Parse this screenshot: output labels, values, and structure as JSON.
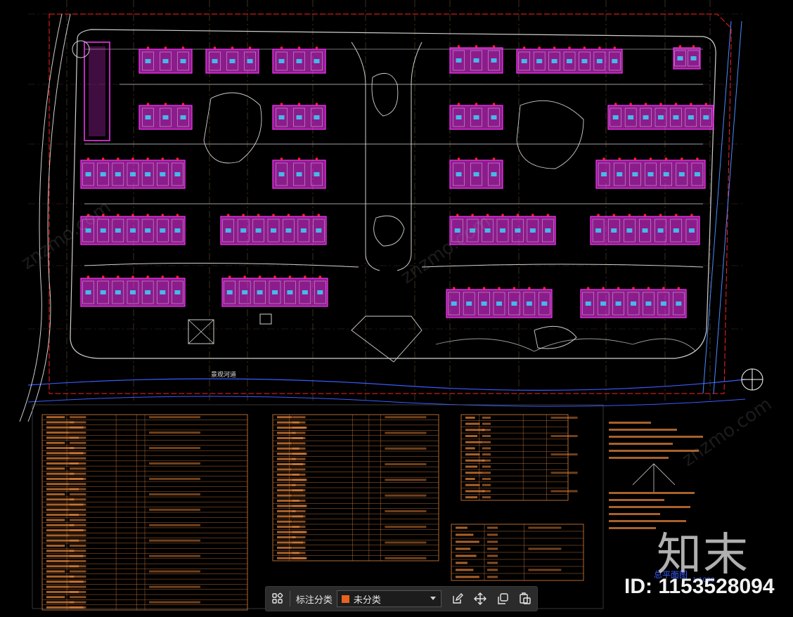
{
  "toolbar": {
    "classify_label": "标注分类",
    "category_value": "未分类",
    "category_color": "#e8631f"
  },
  "watermark": {
    "logo_text": "知末",
    "id_text": "ID: 1153528094"
  },
  "drawing": {
    "background": "#000000",
    "building_color": "#ff33ff",
    "road_color": "#ffffff",
    "grid_color": "#c9a060",
    "red_line_color": "#ff2020",
    "blue_line_color": "#3a5cff",
    "table_color": "#e0813a",
    "plan_title": "总平面图",
    "scale_text": "1:1000",
    "park_label": "景观河道"
  }
}
